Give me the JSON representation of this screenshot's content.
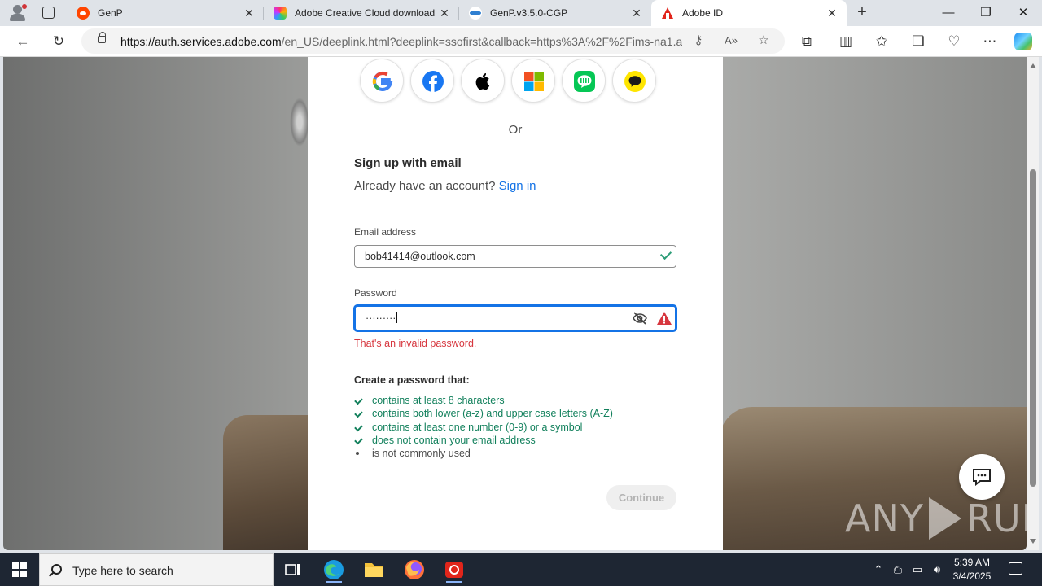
{
  "browser": {
    "tabs": [
      {
        "title": "GenP",
        "favicon": "reddit-icon"
      },
      {
        "title": "Adobe Creative Cloud download",
        "favicon": "creative-cloud-icon"
      },
      {
        "title": "GenP.v3.5.0-CGP",
        "favicon": "cgp-icon"
      },
      {
        "title": "Adobe ID",
        "favicon": "adobe-icon",
        "active": true
      }
    ],
    "close_glyph": "✕",
    "new_tab_glyph": "+",
    "window_controls": {
      "minimize": "—",
      "maximize": "❐",
      "close": "✕"
    },
    "url_host": "https://auth.services.adobe.com",
    "url_path": "/en_US/deeplink.html?deeplink=ssofirst&callback=https%3A%2F%2Fims-na1.a..."
  },
  "page": {
    "social_providers": [
      "google-icon",
      "facebook-icon",
      "apple-icon",
      "microsoft-icon",
      "line-icon",
      "kakaotalk-icon"
    ],
    "divider_text": "Or",
    "heading": "Sign up with email",
    "already_text": "Already have an account?",
    "sign_in_link": "Sign in",
    "email_label": "Email address",
    "email_value": "bob41414@outlook.com",
    "password_label": "Password",
    "password_value": "·········",
    "password_error": "That's an invalid password.",
    "rules_heading": "Create a password that:",
    "rules": [
      {
        "text": "contains at least 8 characters",
        "met": true
      },
      {
        "text": "contains both lower (a-z) and upper case letters (A-Z)",
        "met": true
      },
      {
        "text": "contains at least one number (0-9) or a symbol",
        "met": true
      },
      {
        "text": "does not contain your email address",
        "met": true
      },
      {
        "text": "is not commonly used",
        "met": false
      }
    ],
    "continue_label": "Continue"
  },
  "watermark": {
    "left": "ANY",
    "right": "RUN"
  },
  "taskbar": {
    "search_placeholder": "Type here to search",
    "time": "5:39 AM",
    "date": "3/4/2025"
  },
  "colors": {
    "accent_blue": "#1473e6",
    "error_red": "#d7373f",
    "success_green": "#12805c"
  }
}
